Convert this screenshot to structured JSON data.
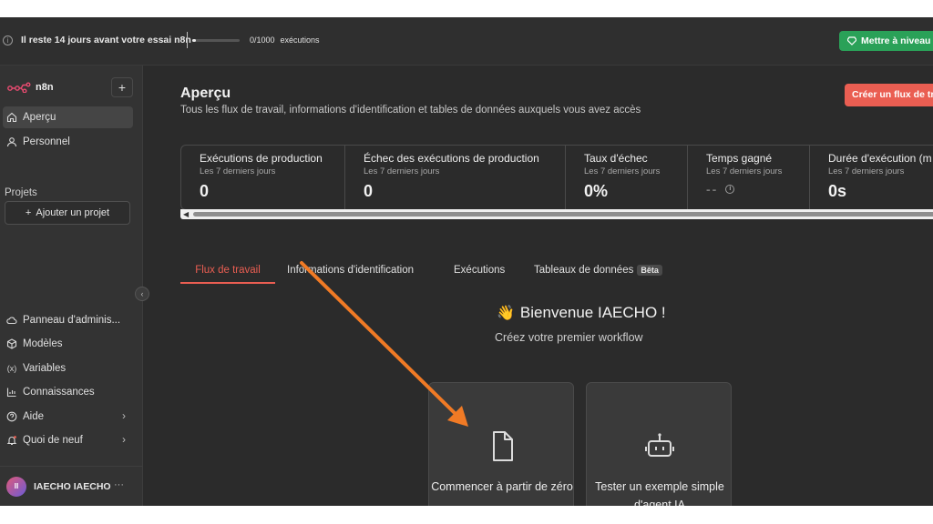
{
  "banner": {
    "trial_text": "Il reste 14 jours avant votre essai n8n",
    "executions_used": "0/1000",
    "executions_unit": "exécutions",
    "executions_progress": 0.0,
    "upgrade_label": "Mettre à niveau"
  },
  "sidebar": {
    "logo_text": "n8n",
    "items": [
      {
        "label": "Aperçu",
        "icon": "home-icon"
      },
      {
        "label": "Personnel",
        "icon": "user-icon"
      }
    ],
    "projects_label": "Projets",
    "add_project_label": "Ajouter un projet",
    "bottom_items": [
      {
        "label": "Panneau d'adminis...",
        "icon": "cloud-icon"
      },
      {
        "label": "Modèles",
        "icon": "box-icon"
      },
      {
        "label": "Variables",
        "icon": "variable-icon"
      },
      {
        "label": "Connaissances",
        "icon": "chart-icon"
      },
      {
        "label": "Aide",
        "icon": "help-icon"
      },
      {
        "label": "Quoi de neuf",
        "icon": "bell-icon"
      }
    ],
    "user": {
      "initials": "II",
      "name": "IAECHO IAECHO",
      "more": "···"
    }
  },
  "main": {
    "title": "Aperçu",
    "subtitle": "Tous les flux de travail, informations d'identification et tables de données auxquels vous avez accès",
    "create_button": "Créer un flux de travail",
    "stats": [
      {
        "label": "Exécutions de production",
        "period": "Les 7 derniers jours",
        "value": "0"
      },
      {
        "label": "Échec des exécutions de production",
        "period": "Les 7 derniers jours",
        "value": "0"
      },
      {
        "label": "Taux d'échec",
        "period": "Les 7 derniers jours",
        "value": "0%"
      },
      {
        "label": "Temps gagné",
        "period": "Les 7 derniers jours",
        "value": "--"
      },
      {
        "label": "Durée d'exécution (m",
        "period": "Les 7 derniers jours",
        "value": "0s"
      }
    ],
    "tabs": [
      {
        "label": "Flux de travail",
        "active": true
      },
      {
        "label": "Informations d'identification",
        "active": false
      },
      {
        "label": "Exécutions",
        "active": false
      },
      {
        "label": "Tableaux de données",
        "active": false,
        "badge": "Bêta"
      }
    ],
    "welcome": {
      "emoji": "👋",
      "title": "Bienvenue IAECHO !",
      "subtitle": "Créez votre premier workflow"
    },
    "cards": [
      {
        "label": "Commencer à partir de zéro",
        "icon": "file-icon"
      },
      {
        "label": "Tester un exemple simple d'agent IA",
        "icon": "robot-icon"
      }
    ]
  },
  "colors": {
    "accent": "#ea5e52",
    "upgrade": "#2aa158",
    "annotation_arrow": "#f07a25"
  }
}
